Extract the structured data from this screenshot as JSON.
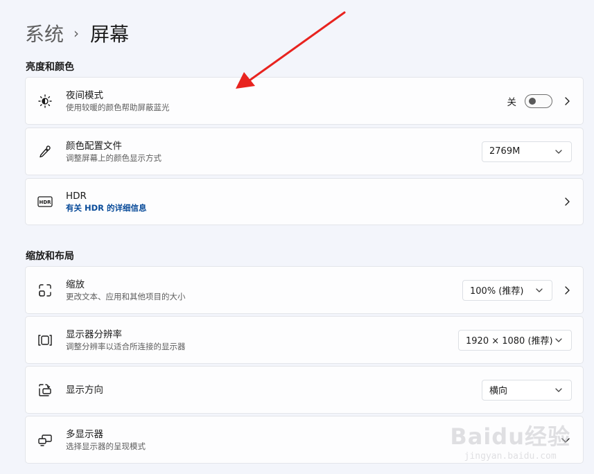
{
  "breadcrumb": {
    "parent": "系统",
    "separator": "›",
    "current": "屏幕"
  },
  "sections": {
    "brightness": "亮度和颜色",
    "scale_layout": "缩放和布局"
  },
  "night_light": {
    "title": "夜间模式",
    "desc": "使用较暖的颜色帮助屏蔽蓝光",
    "toggle_label": "关",
    "toggle_on": false
  },
  "color_profile": {
    "title": "颜色配置文件",
    "desc": "调整屏幕上的颜色显示方式",
    "value": "2769M"
  },
  "hdr": {
    "title": "HDR",
    "link": "有关 HDR 的详细信息"
  },
  "scale": {
    "title": "缩放",
    "desc": "更改文本、应用和其他项目的大小",
    "value": "100% (推荐)"
  },
  "resolution": {
    "title": "显示器分辨率",
    "desc": "调整分辨率以适合所连接的显示器",
    "value": "1920 × 1080 (推荐)"
  },
  "orientation": {
    "title": "显示方向",
    "value": "横向"
  },
  "multi_display": {
    "title": "多显示器",
    "desc": "选择显示器的呈现模式"
  },
  "watermark": {
    "logo": "Baidu经验",
    "sub": "jingyan.baidu.com"
  },
  "colors": {
    "background": "#f3f5fb",
    "card": "#fdfdfe",
    "link": "#0a4c9a",
    "annotation_arrow": "#e8231f"
  },
  "icons": [
    "brightness-icon",
    "eyedropper-icon",
    "hdr-icon",
    "scale-icon",
    "resolution-icon",
    "orientation-icon",
    "multi-display-icon",
    "chevron-right-icon",
    "chevron-down-icon"
  ]
}
